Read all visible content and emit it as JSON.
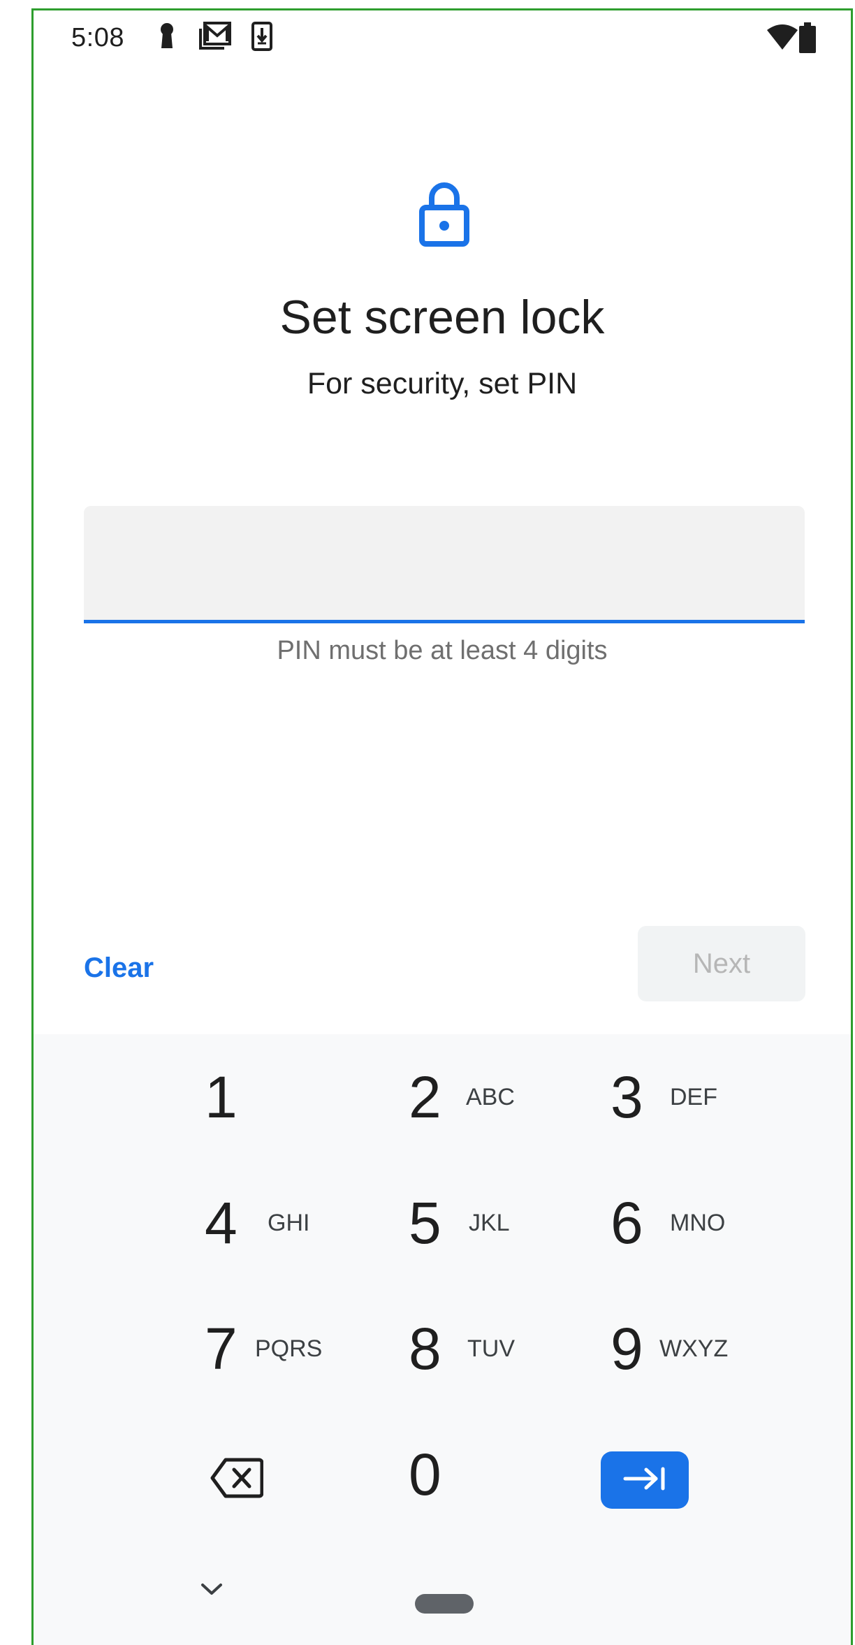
{
  "status_bar": {
    "time": "5:08",
    "icons": [
      "keyhole-icon",
      "mail-icon",
      "download-icon",
      "wifi-icon",
      "battery-icon"
    ]
  },
  "header": {
    "icon": "lock-icon",
    "title": "Set screen lock",
    "subtitle": "For security, set PIN"
  },
  "pin_field": {
    "value": "",
    "hint": "PIN must be at least 4 digits"
  },
  "actions": {
    "clear_label": "Clear",
    "next_label": "Next"
  },
  "keypad": {
    "keys": [
      {
        "digit": "1",
        "letters": ""
      },
      {
        "digit": "2",
        "letters": "ABC"
      },
      {
        "digit": "3",
        "letters": "DEF"
      },
      {
        "digit": "4",
        "letters": "GHI"
      },
      {
        "digit": "5",
        "letters": "JKL"
      },
      {
        "digit": "6",
        "letters": "MNO"
      },
      {
        "digit": "7",
        "letters": "PQRS"
      },
      {
        "digit": "8",
        "letters": "TUV"
      },
      {
        "digit": "9",
        "letters": "WXYZ"
      },
      {
        "digit": "0",
        "letters": ""
      }
    ],
    "backspace_icon": "backspace-icon",
    "done_icon": "tab-arrow-icon",
    "collapse_icon": "chevron-down-icon"
  },
  "colors": {
    "accent": "#1a73e8",
    "frame": "#2e9e2e",
    "keypad_bg": "#f8f9fa",
    "field_bg": "#f2f2f2",
    "disabled_text": "#b6b6b6"
  }
}
